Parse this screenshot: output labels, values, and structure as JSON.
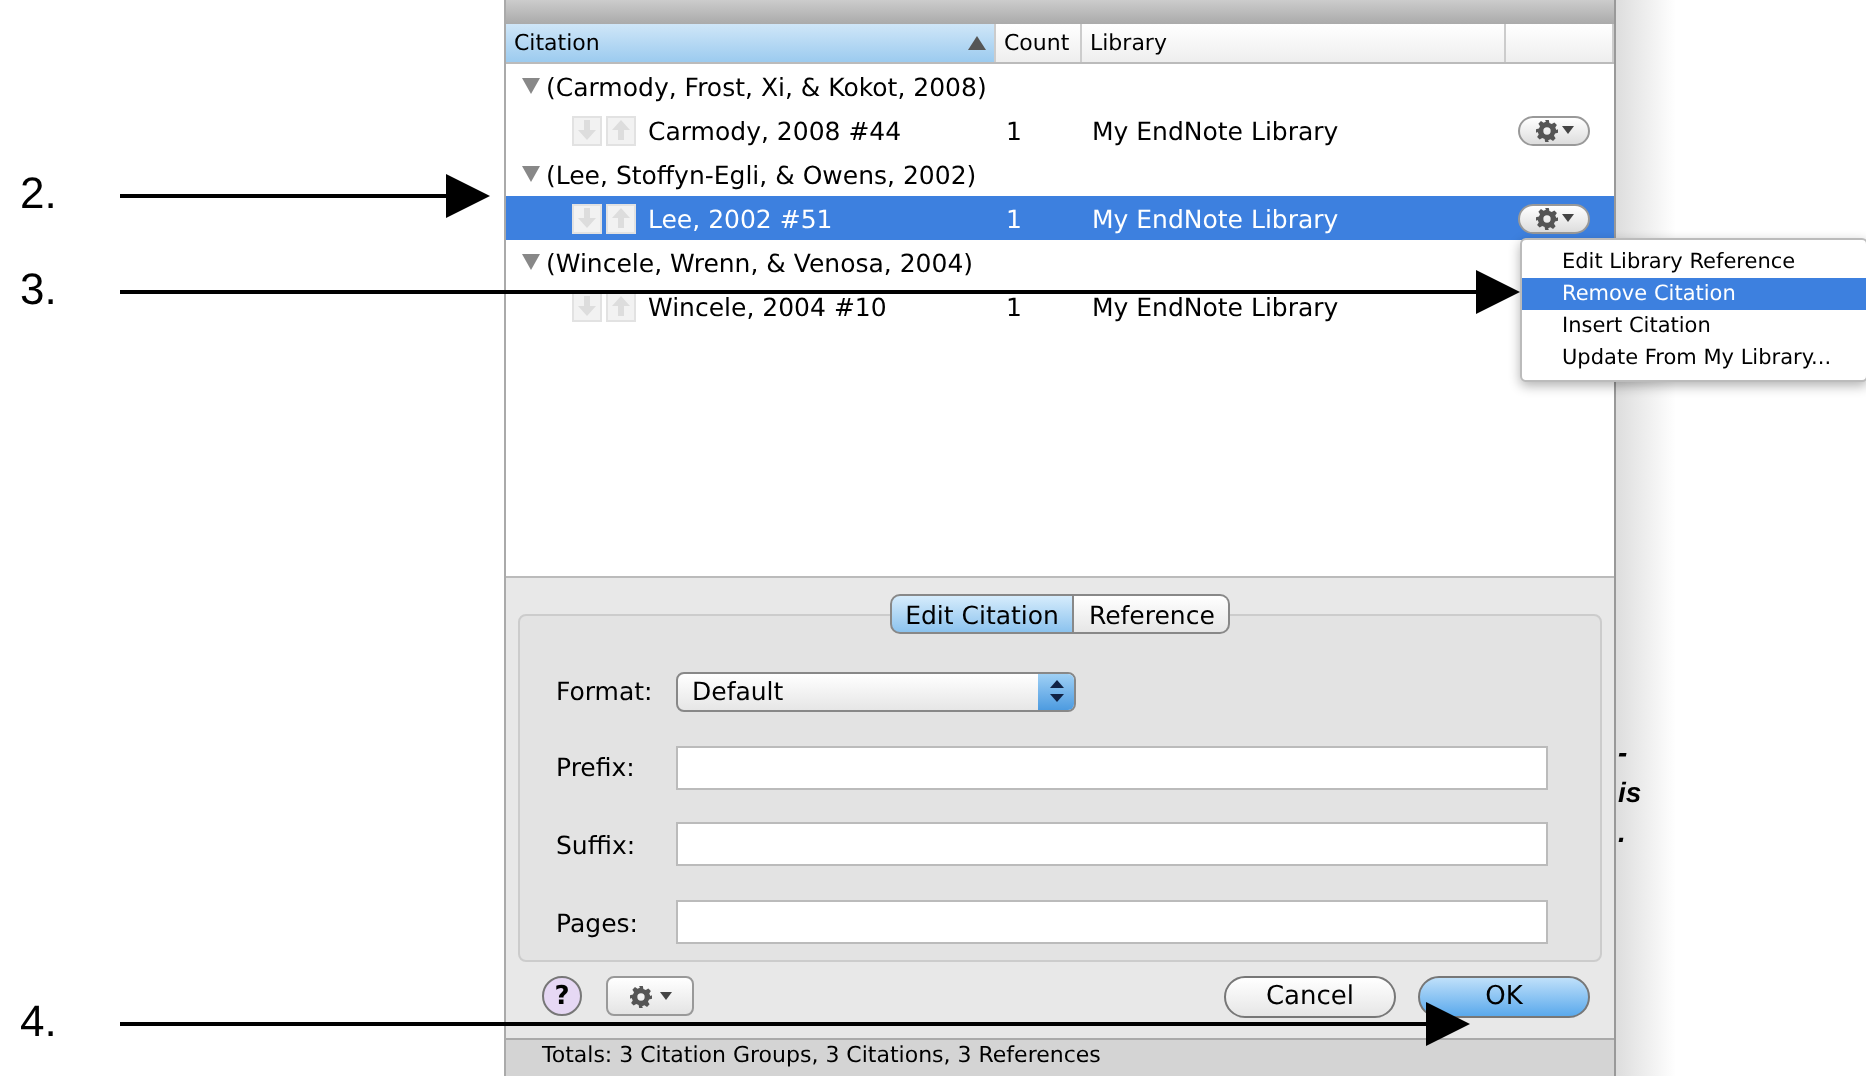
{
  "annotations": [
    {
      "label": "2."
    },
    {
      "label": "3."
    },
    {
      "label": "4."
    }
  ],
  "table": {
    "columns": [
      {
        "label": "Citation",
        "sorted": true
      },
      {
        "label": "Count",
        "sorted": false
      },
      {
        "label": "Library",
        "sorted": false
      }
    ],
    "groups": [
      {
        "label": "(Carmody, Frost, Xi, & Kokot, 2008)",
        "expanded": true,
        "children": [
          {
            "label": "Carmody, 2008 #44",
            "count": "1",
            "library": "My EndNote Library",
            "selected": false,
            "action_button": true
          }
        ]
      },
      {
        "label": "(Lee, Stoffyn-Egli, & Owens, 2002)",
        "expanded": true,
        "children": [
          {
            "label": "Lee, 2002 #51",
            "count": "1",
            "library": "My EndNote Library",
            "selected": true,
            "action_button": true
          }
        ]
      },
      {
        "label": "(Wincele, Wrenn, & Venosa, 2004)",
        "expanded": true,
        "children": [
          {
            "label": "Wincele, 2004 #10",
            "count": "1",
            "library": "My EndNote Library",
            "selected": false,
            "action_button": false
          }
        ]
      }
    ]
  },
  "context_menu": {
    "items": [
      {
        "label": "Edit Library Reference",
        "selected": false
      },
      {
        "label": "Remove Citation",
        "selected": true
      },
      {
        "label": "Insert Citation",
        "selected": false
      },
      {
        "label": "Update From My Library...",
        "selected": false
      }
    ]
  },
  "tabs": [
    {
      "label": "Edit Citation",
      "selected": true
    },
    {
      "label": "Reference",
      "selected": false
    }
  ],
  "form": {
    "format_label": "Format:",
    "format": "Default",
    "fields": [
      {
        "label": "Prefix:"
      },
      {
        "label": "Suffix:"
      },
      {
        "label": "Pages:"
      }
    ]
  },
  "help_button": "?",
  "buttons": [
    {
      "label": "Cancel",
      "default": false
    },
    {
      "label": "OK",
      "default": true
    }
  ],
  "status_bar": "Totals: 3 Citation Groups, 3 Citations, 3 References",
  "background_text": [
    "-",
    "is",
    "."
  ]
}
